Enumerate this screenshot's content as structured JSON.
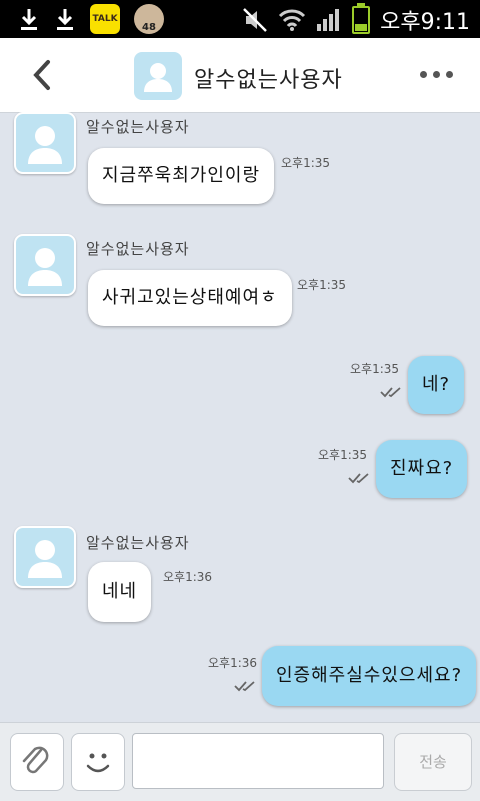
{
  "status_bar": {
    "time": "오후9:11",
    "talk_badge": "TALK",
    "notification_badge": "48"
  },
  "header": {
    "title": "알수없는사용자",
    "back_icon": "back-chevron-icon",
    "more_icon": "more-dots-icon"
  },
  "messages": [
    {
      "direction": "in",
      "sender": "알수없는사용자",
      "text": "지금쭈욱최가인이랑",
      "time": "오후1:35"
    },
    {
      "direction": "in",
      "sender": "알수없는사용자",
      "text": "사귀고있는상태예여ㅎ",
      "time": "오후1:35"
    },
    {
      "direction": "out",
      "text": "네?",
      "time": "오후1:35",
      "read_icon": "double-check-icon"
    },
    {
      "direction": "out",
      "text": "진짜요?",
      "time": "오후1:35",
      "read_icon": "double-check-icon"
    },
    {
      "direction": "in",
      "sender": "알수없는사용자",
      "text": "네네",
      "time": "오후1:36"
    },
    {
      "direction": "out",
      "text": "인증해주실수있으세요?",
      "time": "오후1:36",
      "read_icon": "double-check-icon"
    }
  ],
  "input_bar": {
    "attach_icon": "paperclip-icon",
    "emoji_icon": "smiley-icon",
    "message_value": "",
    "send_label": "전송"
  }
}
